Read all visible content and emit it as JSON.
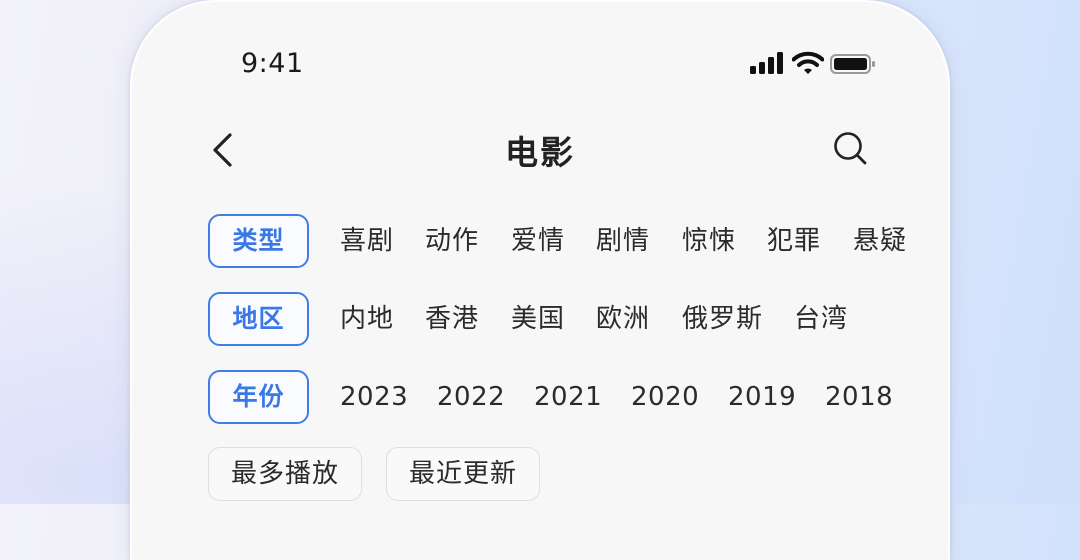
{
  "status_bar": {
    "time": "9:41",
    "icons": [
      "signal-icon",
      "wifi-icon",
      "battery-icon"
    ]
  },
  "nav": {
    "title": "电影",
    "back_icon": "chevron-left-icon",
    "search_icon": "search-icon"
  },
  "filters": {
    "type": {
      "label": "类型",
      "options": [
        "喜剧",
        "动作",
        "爱情",
        "剧情",
        "惊悚",
        "犯罪",
        "悬疑"
      ]
    },
    "region": {
      "label": "地区",
      "options": [
        "内地",
        "香港",
        "美国",
        "欧洲",
        "俄罗斯",
        "台湾"
      ]
    },
    "year": {
      "label": "年份",
      "options": [
        "2023",
        "2022",
        "2021",
        "2020",
        "2019",
        "2018"
      ]
    }
  },
  "sort": {
    "options": [
      "最多播放",
      "最近更新"
    ]
  },
  "colors": {
    "accent": "#3a78e6",
    "text": "#2b2b2b",
    "phone_bg": "#f7f7f7"
  }
}
